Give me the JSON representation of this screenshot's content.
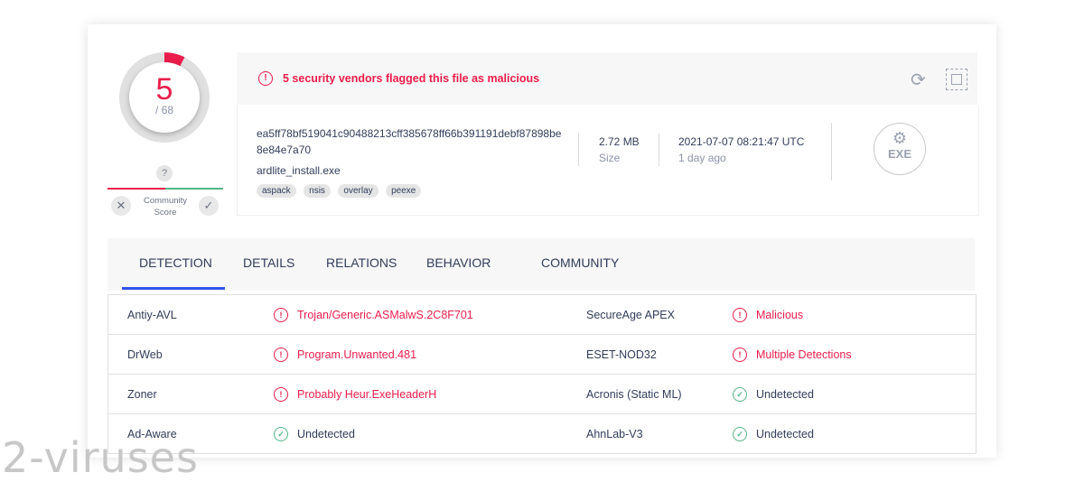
{
  "score": {
    "detected": "5",
    "total": "/ 68"
  },
  "community": {
    "question": "?",
    "label": "Community Score",
    "dislike": "✕",
    "like": "✓"
  },
  "banner": {
    "alert_icon": "!",
    "message": "5 security vendors flagged this file as malicious"
  },
  "file": {
    "hash": "ea5ff78bf519041c90488213cff385678ff66b391191debf87898be8e84e7a70",
    "name": "ardlite_install.exe",
    "tags": [
      "aspack",
      "nsis",
      "overlay",
      "peexe"
    ],
    "size_value": "2.72 MB",
    "size_label": "Size",
    "date_value": "2021-07-07 08:21:47 UTC",
    "date_label": "1 day ago",
    "type_label": "EXE"
  },
  "tabs": [
    "DETECTION",
    "DETAILS",
    "RELATIONS",
    "BEHAVIOR",
    "COMMUNITY"
  ],
  "results": [
    [
      {
        "vendor": "Antiy-AVL",
        "result": "Trojan/Generic.ASMalwS.2C8F701",
        "status": "bad"
      },
      {
        "vendor": "SecureAge APEX",
        "result": "Malicious",
        "status": "bad"
      }
    ],
    [
      {
        "vendor": "DrWeb",
        "result": "Program.Unwanted.481",
        "status": "bad"
      },
      {
        "vendor": "ESET-NOD32",
        "result": "Multiple Detections",
        "status": "bad"
      }
    ],
    [
      {
        "vendor": "Zoner",
        "result": "Probably Heur.ExeHeaderH",
        "status": "bad"
      },
      {
        "vendor": "Acronis (Static ML)",
        "result": "Undetected",
        "status": "good"
      }
    ],
    [
      {
        "vendor": "Ad-Aware",
        "result": "Undetected",
        "status": "good"
      },
      {
        "vendor": "AhnLab-V3",
        "result": "Undetected",
        "status": "good"
      }
    ]
  ],
  "watermark": "2-viruses",
  "colors": {
    "malicious": "#ea1d4c",
    "clean": "#52b788",
    "tab_active": "#3354e8"
  }
}
